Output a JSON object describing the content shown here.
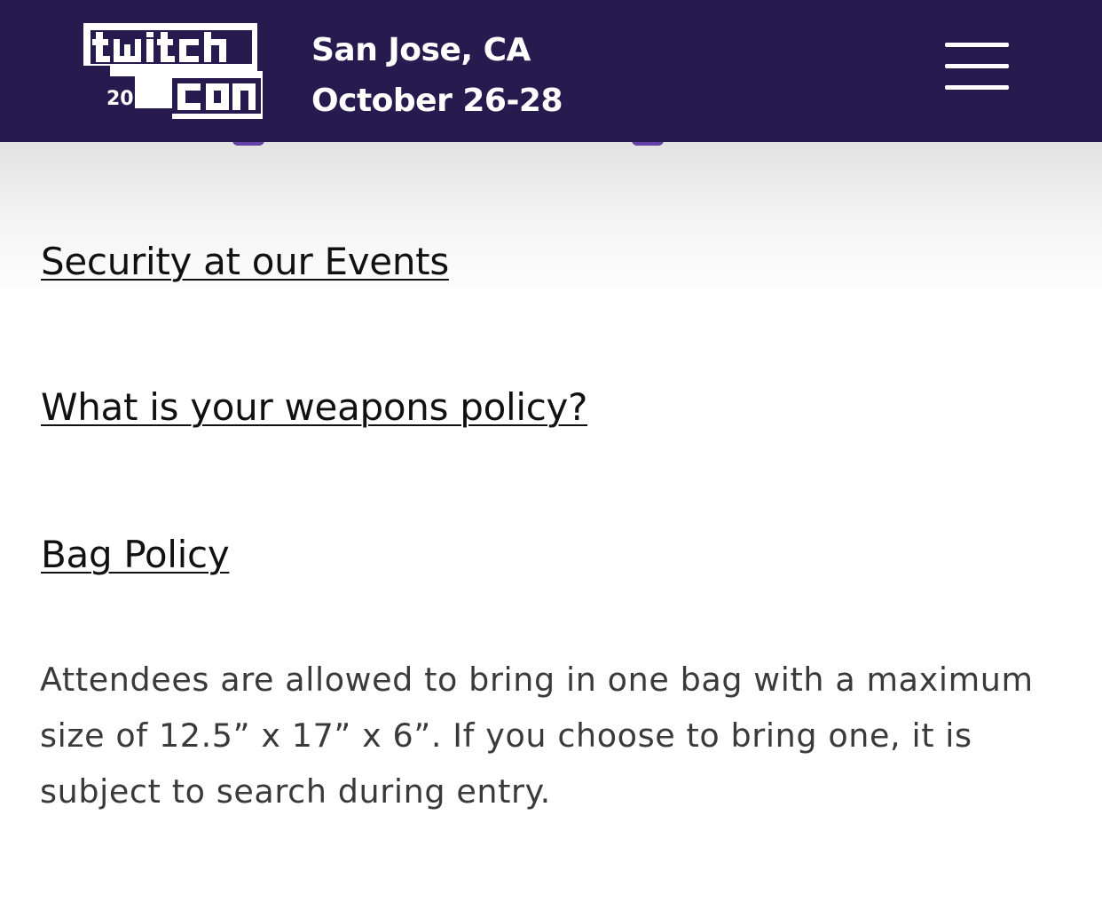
{
  "header": {
    "logo": {
      "alt": "twitch con 2018",
      "wordmark_top": "twitch",
      "wordmark_bottom": "con",
      "year": "2018"
    },
    "location": "San Jose, CA",
    "dates": "October 26-28",
    "menu_icon": "hamburger-menu-icon",
    "background_color": "#261a4f"
  },
  "faq": {
    "questions": [
      {
        "label": "Security at our Events"
      },
      {
        "label": "What is your weapons policy?"
      },
      {
        "label": "Bag Policy"
      }
    ],
    "answer": "Attendees are allowed to bring in one bag with a maximum size of 12.5” x 17” x 6”. If you choose to bring one, it is subject to search during entry."
  },
  "colors": {
    "brand_purple": "#6441a4",
    "header_bg": "#261a4f",
    "link_text": "#111111",
    "body_text": "#3a3a3a"
  }
}
